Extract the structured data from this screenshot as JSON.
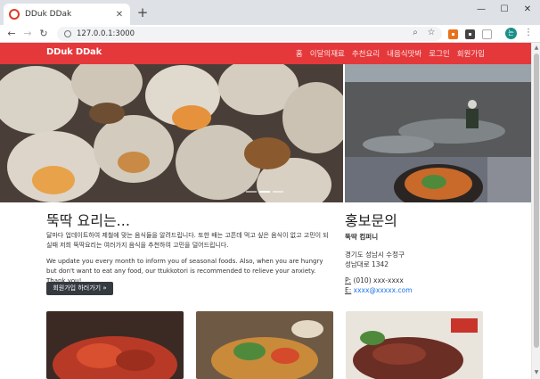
{
  "browser": {
    "tab_title": "DDuk DDak",
    "url": "127.0.0.1:3000",
    "profile_initial": "는"
  },
  "site": {
    "brand": "DDuk DDak",
    "nav": [
      "홈",
      "이달의재료",
      "추천요리",
      "내음식맛봐",
      "로그인",
      "회원가입"
    ],
    "headline": "뚝딱 요리는...",
    "intro_ko": "달마다 업데이트하여 제철에 맞는 음식들을 알려드립니다. 또한 배는 고픈데 먹고 싶은 음식이 없고 고민이 되실때 저희 뚝딱요리는 여러가지 음식을 추천하여 고민을 덜어드립니다.",
    "intro_en": "We update you every month to inform you of seasonal foods. Also, when you are hungry but don't want to eat any food, our ttukkotori is recommended to relieve your anxiety. Thank you!",
    "cta_label": "회원가입 하러가기 »",
    "contact": {
      "title": "홍보문의",
      "company": "뚝딱 컴퍼니",
      "address_line1": "경기도 성남시 수정구",
      "address_line2": "성남대로 1342",
      "phone_prefix": "P:",
      "phone": "(010) xxx-xxxx",
      "email_prefix": "E:",
      "email": "xxxx@xxxxx.com"
    }
  },
  "colors": {
    "navbar": "#e5383b",
    "button": "#343a40",
    "link": "#1a73e8"
  }
}
